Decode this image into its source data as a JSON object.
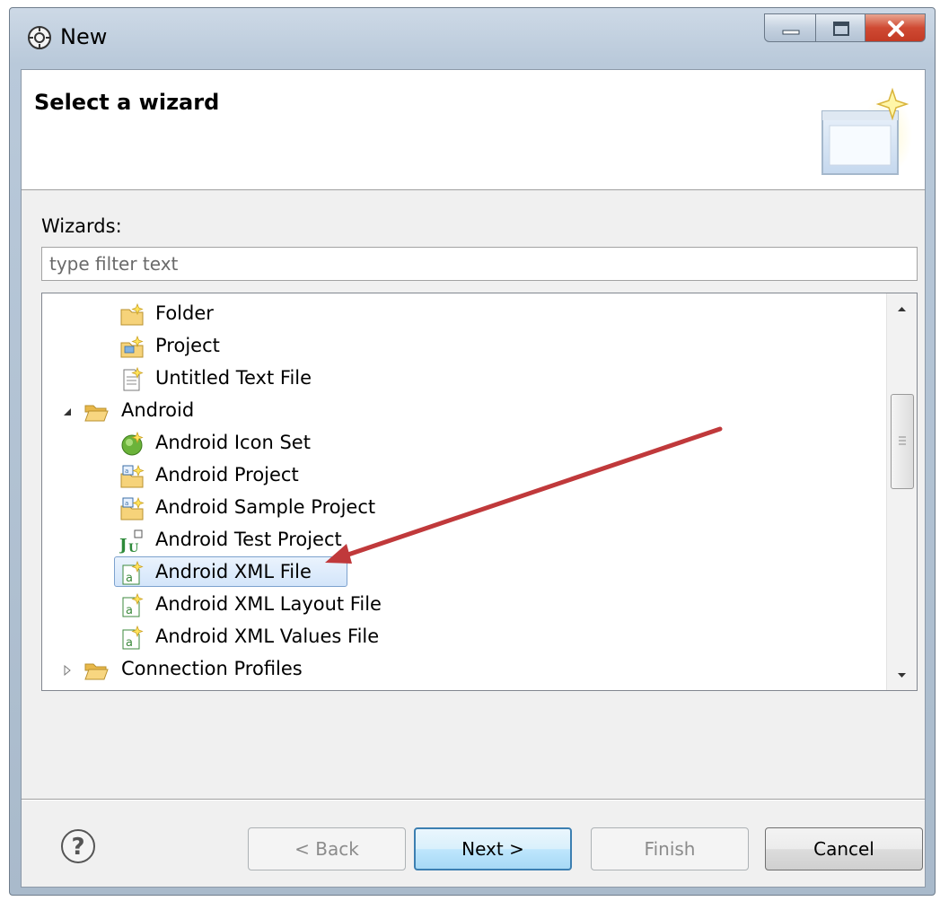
{
  "window": {
    "title": "New"
  },
  "header": {
    "title": "Select a wizard"
  },
  "wizards": {
    "label": "Wizards:",
    "filter_placeholder": "type filter text"
  },
  "tree": {
    "items": [
      {
        "label": "Folder",
        "icon": "folder-new-icon",
        "level": 2
      },
      {
        "label": "Project",
        "icon": "project-new-icon",
        "level": 2
      },
      {
        "label": "Untitled Text File",
        "icon": "text-file-new-icon",
        "level": 2
      },
      {
        "label": "Android",
        "icon": "folder-open-icon",
        "level": 1,
        "expanded": true
      },
      {
        "label": "Android Icon Set",
        "icon": "android-icon-set-icon",
        "level": 2
      },
      {
        "label": "Android Project",
        "icon": "android-project-icon",
        "level": 2
      },
      {
        "label": "Android Sample Project",
        "icon": "android-project-icon",
        "level": 2
      },
      {
        "label": "Android Test Project",
        "icon": "junit-icon",
        "level": 2
      },
      {
        "label": "Android XML File",
        "icon": "android-xml-icon",
        "level": 2,
        "selected": true
      },
      {
        "label": "Android XML Layout File",
        "icon": "android-xml-icon",
        "level": 2
      },
      {
        "label": "Android XML Values File",
        "icon": "android-xml-icon",
        "level": 2
      },
      {
        "label": "Connection Profiles",
        "icon": "folder-open-icon",
        "level": 1,
        "expanded": false
      }
    ]
  },
  "buttons": {
    "back": "< Back",
    "next": "Next >",
    "finish": "Finish",
    "cancel": "Cancel"
  },
  "colors": {
    "annotation_arrow": "#c0393b",
    "selection_border": "#7da2ce",
    "default_button_border": "#3c7fb1"
  }
}
